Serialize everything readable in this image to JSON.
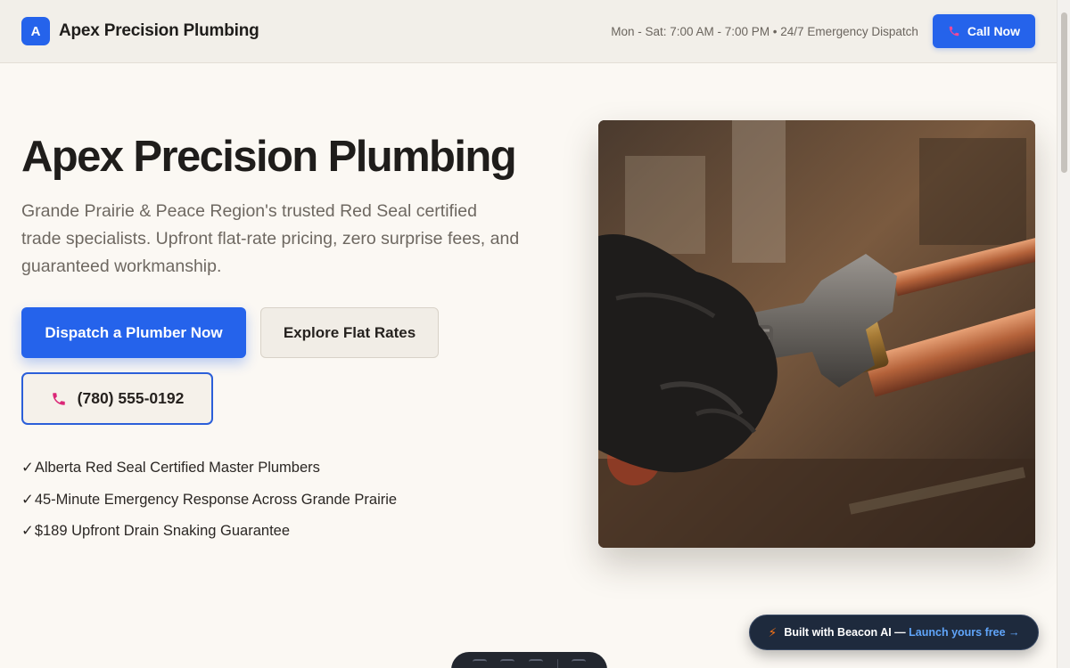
{
  "header": {
    "logo_letter": "A",
    "brand_name": "Apex Precision Plumbing",
    "hours": "Mon - Sat: 7:00 AM - 7:00 PM • 24/7 Emergency Dispatch",
    "call_label": "Call Now"
  },
  "hero": {
    "title": "Apex Precision Plumbing",
    "subtitle": "Grande Prairie & Peace Region's trusted Red Seal certified trade specialists. Upfront flat-rate pricing, zero surprise fees, and guaranteed workmanship.",
    "primary_cta": "Dispatch a Plumber Now",
    "secondary_cta": "Explore Flat Rates",
    "phone": "(780) 555-0192",
    "features": [
      "Alberta Red Seal Certified Master Plumbers",
      "45-Minute Emergency Response Across Grande Prairie",
      "$189 Upfront Drain Snaking Guarantee"
    ],
    "check_mark": "✓"
  },
  "badge": {
    "bolt": "⚡",
    "text": "Built with Beacon AI — ",
    "link": "Launch yours free →"
  },
  "colors": {
    "accent": "#2563eb",
    "background": "#fbf8f3",
    "phone_icon": "#db2777"
  },
  "icons": {
    "call_icon": "phone-icon",
    "badge_icon": "bolt-icon"
  }
}
